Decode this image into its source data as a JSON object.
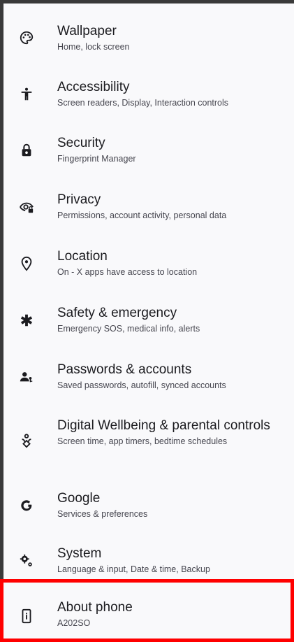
{
  "settings": {
    "items": [
      {
        "title": "Wallpaper",
        "subtitle": "Home, lock screen",
        "icon": "palette-icon"
      },
      {
        "title": "Accessibility",
        "subtitle": "Screen readers, Display, Interaction controls",
        "icon": "accessibility-icon"
      },
      {
        "title": "Security",
        "subtitle": "Fingerprint Manager",
        "icon": "lock-icon"
      },
      {
        "title": "Privacy",
        "subtitle": "Permissions, account activity, personal data",
        "icon": "privacy-eye-lock-icon"
      },
      {
        "title": "Location",
        "subtitle": "On - X apps have access to location",
        "icon": "location-pin-icon"
      },
      {
        "title": "Safety & emergency",
        "subtitle": "Emergency SOS, medical info, alerts",
        "icon": "asterisk-icon"
      },
      {
        "title": "Passwords & accounts",
        "subtitle": "Saved passwords, autofill, synced accounts",
        "icon": "account-key-icon"
      },
      {
        "title": "Digital Wellbeing & parental controls",
        "subtitle": "Screen time, app timers, bedtime schedules",
        "icon": "wellbeing-icon"
      },
      {
        "title": "Google",
        "subtitle": "Services & preferences",
        "icon": "google-g-icon"
      },
      {
        "title": "System",
        "subtitle": "Language & input, Date & time, Backup",
        "icon": "system-gears-icon"
      },
      {
        "title": "About phone",
        "subtitle": "A202SO",
        "icon": "phone-info-icon"
      }
    ]
  },
  "colors": {
    "highlight": "#ff0000"
  }
}
